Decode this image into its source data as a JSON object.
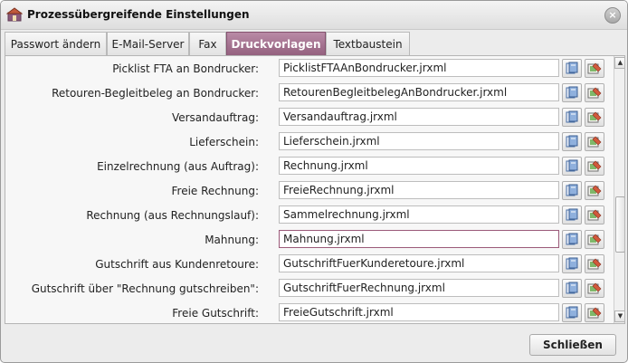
{
  "window": {
    "title": "Prozessübergreifende Einstellungen"
  },
  "tabs": [
    {
      "label": "Passwort ändern"
    },
    {
      "label": "E-Mail-Server"
    },
    {
      "label": "Fax"
    },
    {
      "label": "Druckvorlagen",
      "active": true
    },
    {
      "label": "Textbaustein"
    }
  ],
  "rows": [
    {
      "label": "Picklist FTA an Bondrucker:",
      "value": "PicklistFTAAnBondrucker.jrxml"
    },
    {
      "label": "Retouren-Begleitbeleg an Bondrucker:",
      "value": "RetourenBegleitbelegAnBondrucker.jrxml"
    },
    {
      "label": "Versandauftrag:",
      "value": "Versandauftrag.jrxml"
    },
    {
      "label": "Lieferschein:",
      "value": "Lieferschein.jrxml"
    },
    {
      "label": "Einzelrechnung (aus Auftrag):",
      "value": "Rechnung.jrxml"
    },
    {
      "label": "Freie Rechnung:",
      "value": "FreieRechnung.jrxml"
    },
    {
      "label": "Rechnung (aus Rechnungslauf):",
      "value": "Sammelrechnung.jrxml"
    },
    {
      "label": "Mahnung:",
      "value": "Mahnung.jrxml",
      "focused": true
    },
    {
      "label": "Gutschrift aus Kundenretoure:",
      "value": "GutschriftFuerKunderetoure.jrxml"
    },
    {
      "label": "Gutschrift über \"Rechnung gutschreiben\":",
      "value": "GutschriftFuerRechnung.jrxml"
    },
    {
      "label": "Freie Gutschrift:",
      "value": "FreieGutschrift.jrxml"
    }
  ],
  "footer": {
    "close_label": "Schließen"
  },
  "icons": {
    "app": "window-app-icon",
    "close": "close-icon",
    "open": "folder-open-icon",
    "edit": "edit-template-icon"
  },
  "colors": {
    "active_tab": "#a97193",
    "focus_border": "#9b5a79"
  }
}
